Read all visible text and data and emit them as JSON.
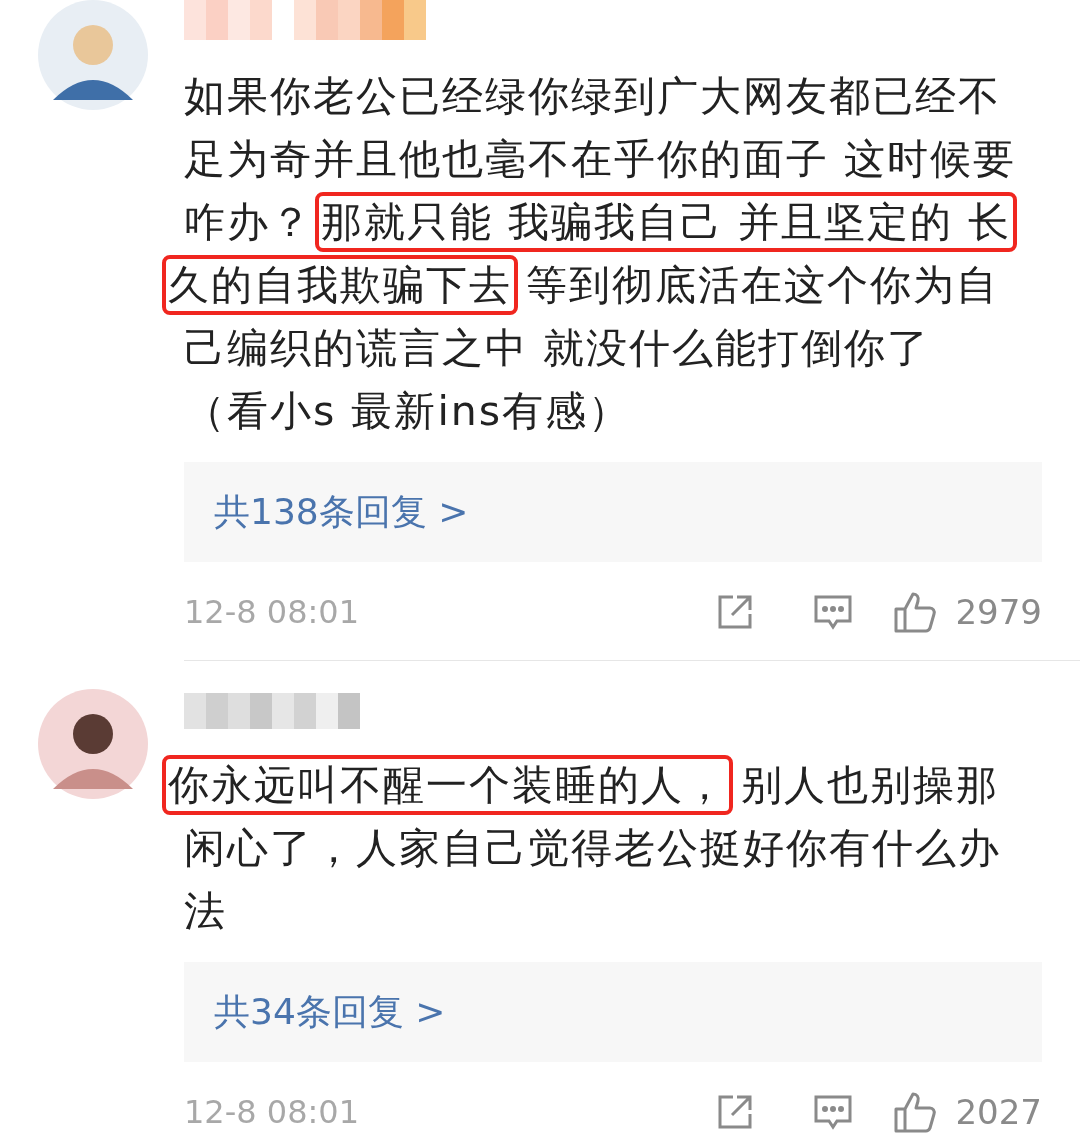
{
  "comments": [
    {
      "lines": [
        [
          {
            "text": "如果你老公已经绿你绿到广大网友都已经不",
            "highlighted": false
          }
        ],
        [
          {
            "text": "足为奇并且他也毫不在乎你的面子 这时候要",
            "highlighted": false
          }
        ],
        [
          {
            "text": "咋办？",
            "highlighted": false
          },
          {
            "text": "那就只能 我骗我自己 并且坚定的 长",
            "highlighted": true
          }
        ],
        [
          {
            "text": "久的自我欺骗下去",
            "highlighted": true
          },
          {
            "text": "等到彻底活在这个你为自",
            "highlighted": false
          }
        ],
        [
          {
            "text": "己编织的谎言之中 就没什么能打倒你了",
            "highlighted": false
          }
        ],
        [
          {
            "text": "（看小s 最新ins有感）",
            "highlighted": false
          }
        ]
      ],
      "reply_count": "共138条回复 >",
      "time": "12-8 08:01",
      "likes": "2979"
    },
    {
      "lines": [
        [
          {
            "text": "你永远叫不醒一个装睡的人，",
            "highlighted": true
          },
          {
            "text": "别人也别操那",
            "highlighted": false
          }
        ],
        [
          {
            "text": "闲心了，人家自己觉得老公挺好你有什么办",
            "highlighted": false
          }
        ],
        [
          {
            "text": "法",
            "highlighted": false
          }
        ]
      ],
      "reply_count": "共34条回复 >",
      "time": "12-8 08:01",
      "likes": "2027"
    }
  ]
}
